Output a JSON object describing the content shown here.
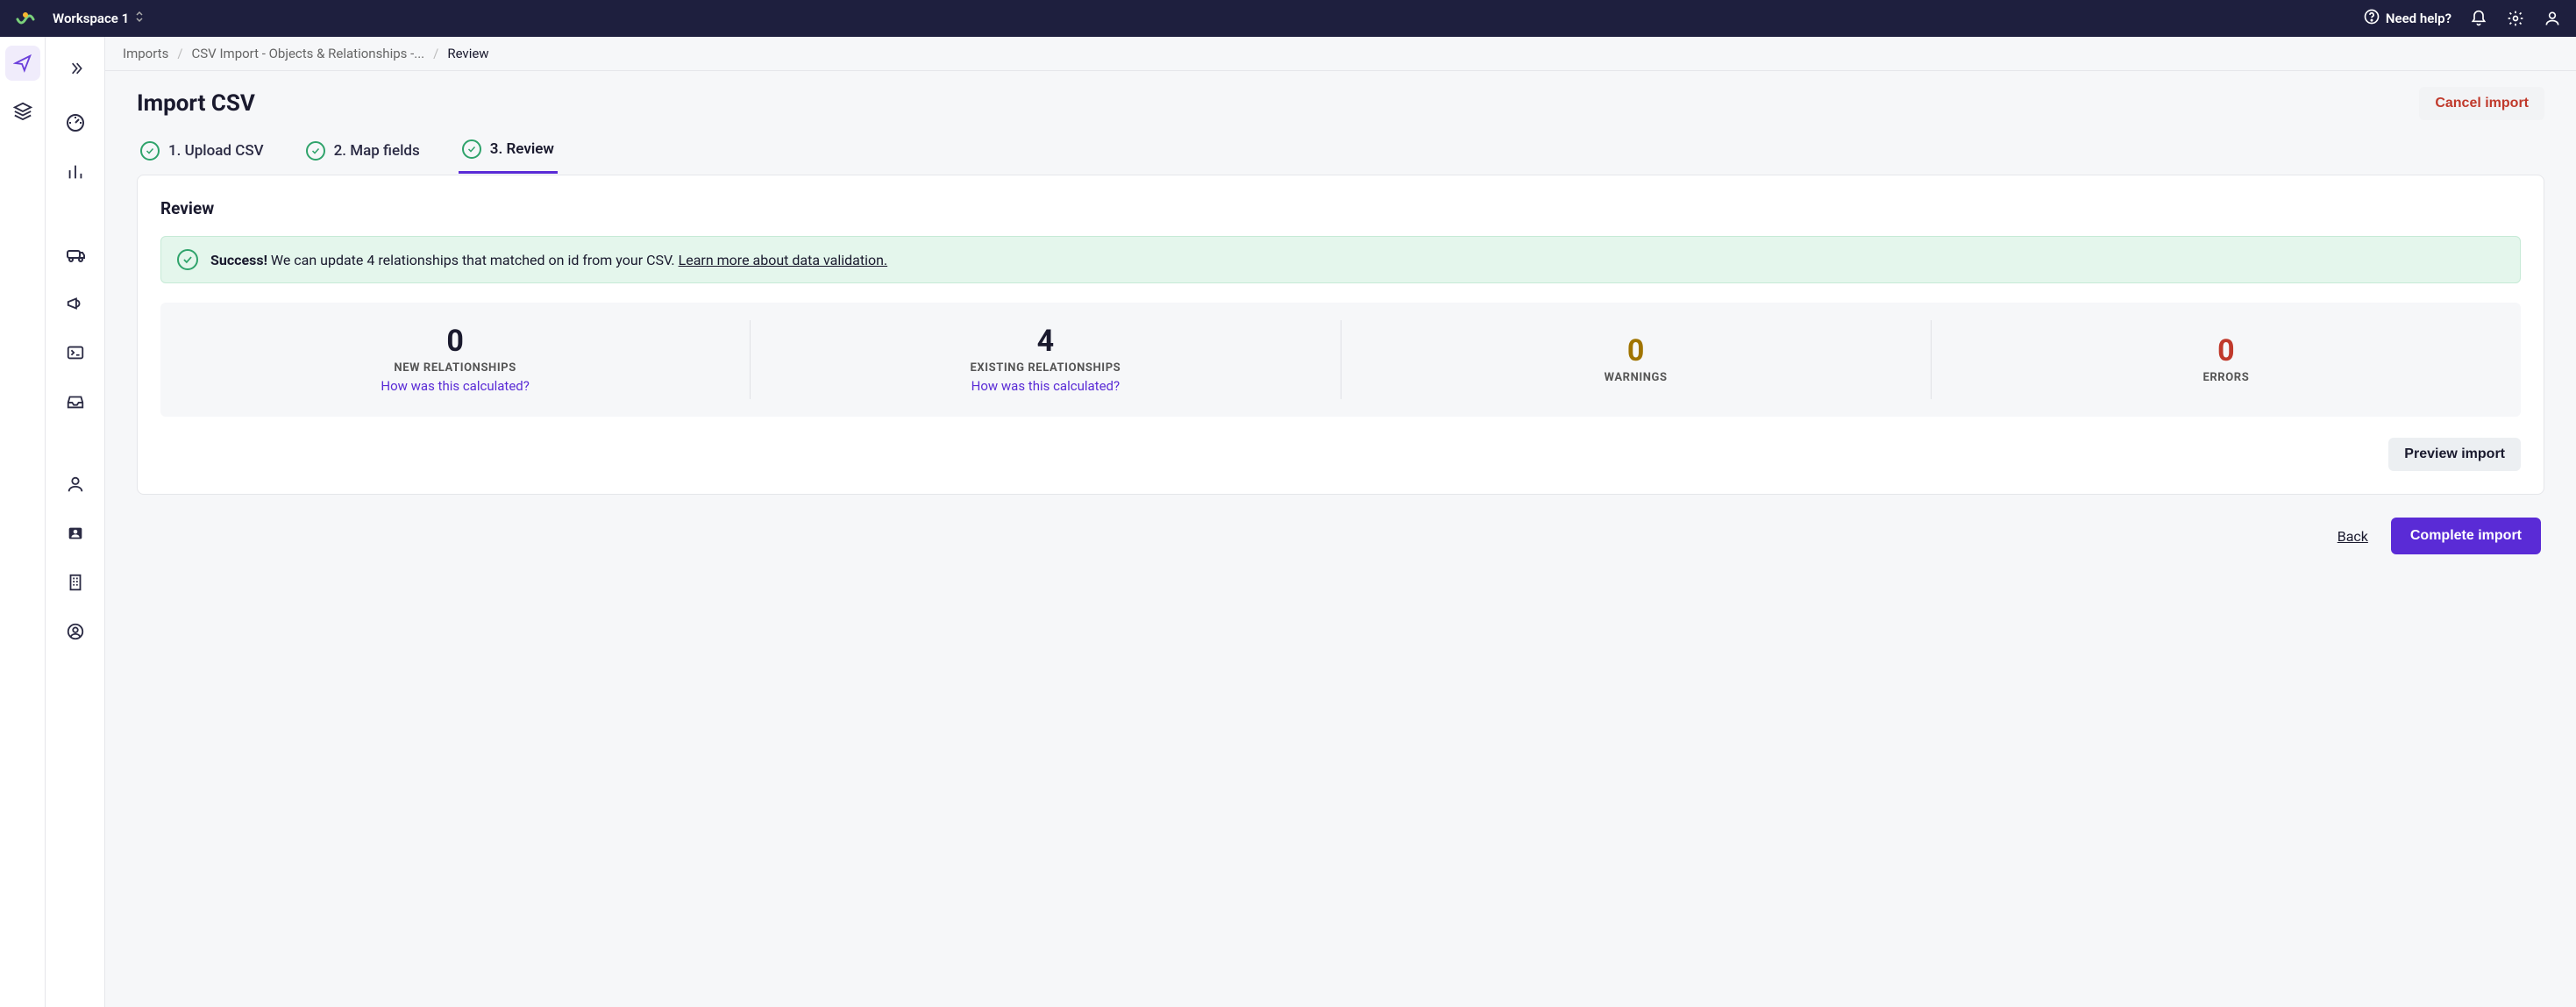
{
  "topbar": {
    "workspace_label": "Workspace 1",
    "help_label": "Need help?"
  },
  "breadcrumb": {
    "items": [
      {
        "label": "Imports"
      },
      {
        "label": "CSV Import - Objects & Relationships -..."
      },
      {
        "label": "Review"
      }
    ]
  },
  "page": {
    "title": "Import CSV",
    "cancel_label": "Cancel import"
  },
  "steps": [
    {
      "label": "1. Upload CSV"
    },
    {
      "label": "2. Map fields"
    },
    {
      "label": "3. Review"
    }
  ],
  "card": {
    "title": "Review"
  },
  "banner": {
    "strong": "Success!",
    "message": " We can update 4 relationships that matched on id from your CSV. ",
    "link": "Learn more about data validation."
  },
  "stats": {
    "new_relationships": {
      "value": "0",
      "label": "NEW RELATIONSHIPS",
      "link_label": "How was this calculated?"
    },
    "existing_relationships": {
      "value": "4",
      "label": "EXISTING RELATIONSHIPS",
      "link_label": "How was this calculated?"
    },
    "warnings": {
      "value": "0",
      "label": "WARNINGS"
    },
    "errors": {
      "value": "0",
      "label": "ERRORS"
    }
  },
  "actions": {
    "preview_label": "Preview import",
    "back_label": "Back",
    "complete_label": "Complete import"
  }
}
